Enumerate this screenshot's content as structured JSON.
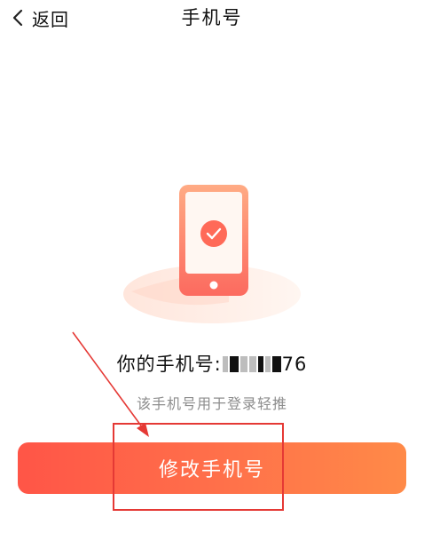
{
  "header": {
    "back_label": "返回",
    "title": "手机号"
  },
  "main": {
    "phone_prefix": "你的手机号:",
    "phone_number_visible_suffix": "76",
    "note": "该手机号用于登录轻推"
  },
  "action": {
    "change_phone_label": "修改手机号"
  },
  "colors": {
    "accent_start": "#ff5547",
    "accent_end": "#ff8a48",
    "annotation": "#e53935"
  }
}
